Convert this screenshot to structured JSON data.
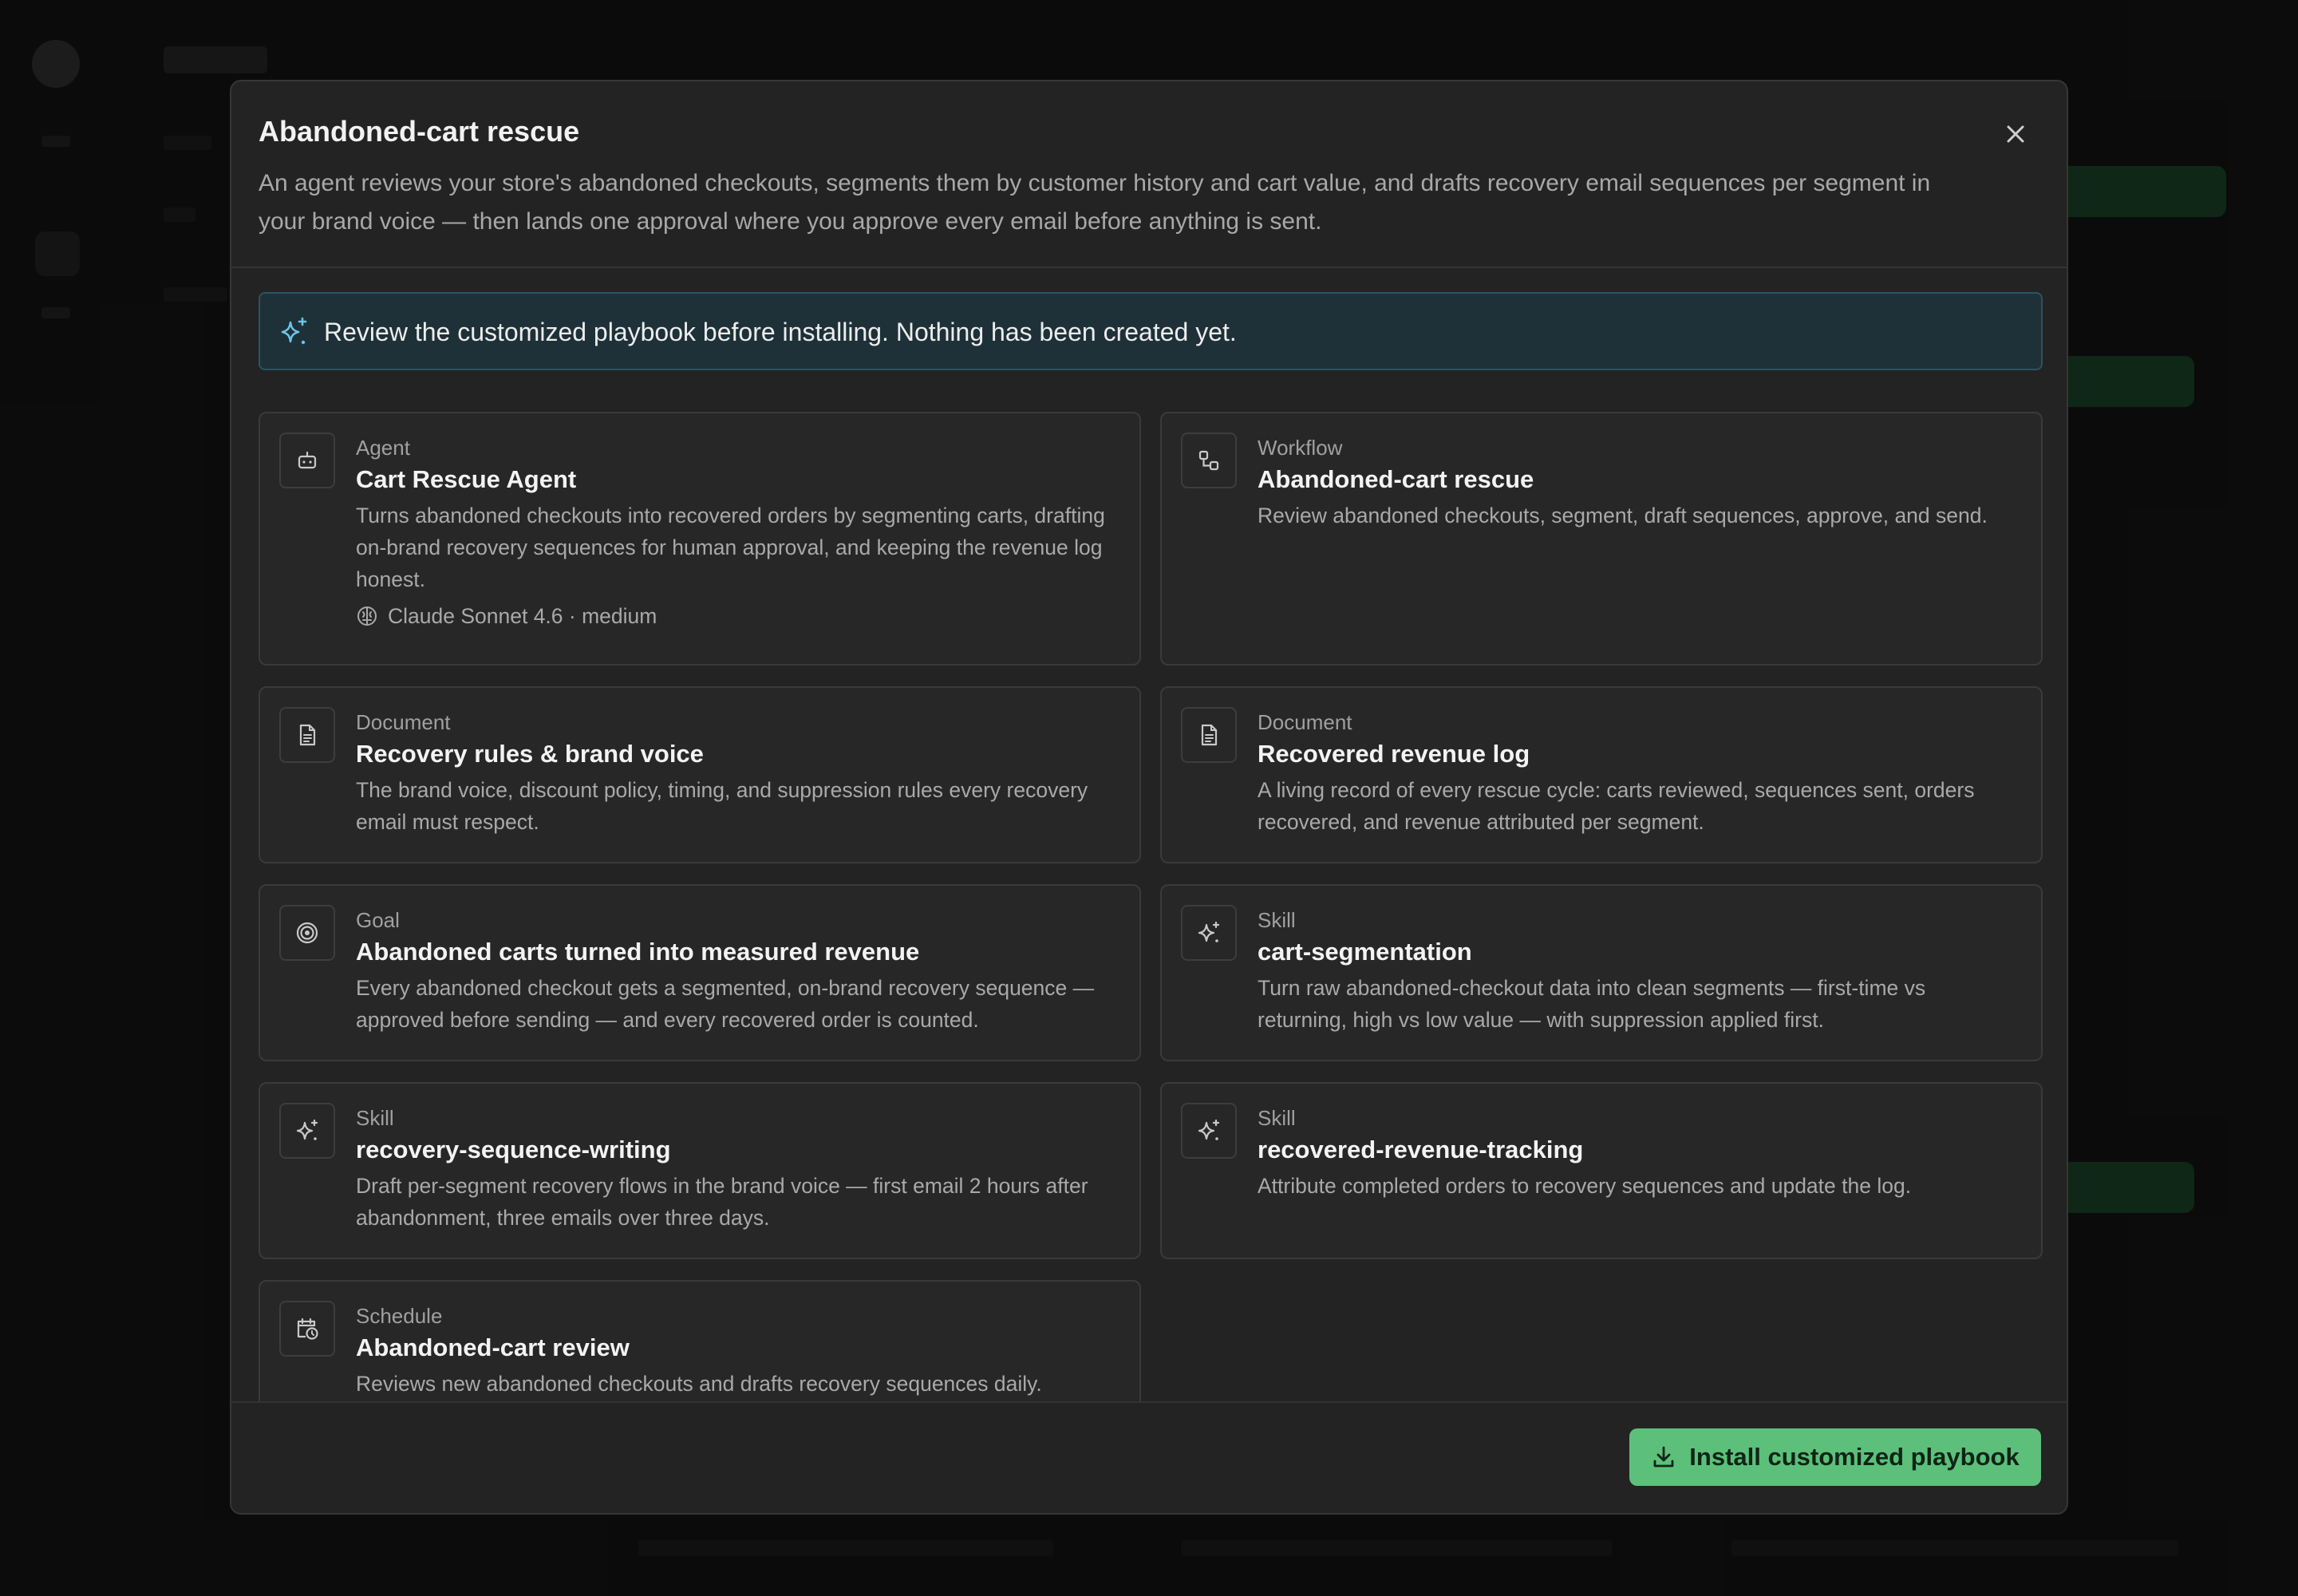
{
  "modal": {
    "title": "Abandoned-cart rescue",
    "description": "An agent reviews your store's abandoned checkouts, segments them by customer history and cart value, and drafts recovery email sequences per segment in your brand voice — then lands one approval where you approve every email before anything is sent."
  },
  "banner": {
    "text": "Review the customized playbook before installing. Nothing has been created yet."
  },
  "cards": [
    {
      "type": "Agent",
      "name": "Cart Rescue Agent",
      "description": "Turns abandoned checkouts into recovered orders by segmenting carts, drafting on-brand recovery sequences for human approval, and keeping the revenue log honest.",
      "model": "Claude Sonnet 4.6 · medium",
      "icon": "robot-icon"
    },
    {
      "type": "Workflow",
      "name": "Abandoned-cart rescue",
      "description": "Review abandoned checkouts, segment, draft sequences, approve, and send.",
      "icon": "workflow-icon"
    },
    {
      "type": "Document",
      "name": "Recovery rules & brand voice",
      "description": "The brand voice, discount policy, timing, and suppression rules every recovery email must respect.",
      "icon": "document-icon"
    },
    {
      "type": "Document",
      "name": "Recovered revenue log",
      "description": "A living record of every rescue cycle: carts reviewed, sequences sent, orders recovered, and revenue attributed per segment.",
      "icon": "document-icon"
    },
    {
      "type": "Goal",
      "name": "Abandoned carts turned into measured revenue",
      "description": "Every abandoned checkout gets a segmented, on-brand recovery sequence — approved before sending — and every recovered order is counted.",
      "icon": "target-icon"
    },
    {
      "type": "Skill",
      "name": "cart-segmentation",
      "description": "Turn raw abandoned-checkout data into clean segments — first-time vs returning, high vs low value — with suppression applied first.",
      "icon": "sparkle-icon"
    },
    {
      "type": "Skill",
      "name": "recovery-sequence-writing",
      "description": "Draft per-segment recovery flows in the brand voice — first email 2 hours after abandonment, three emails over three days.",
      "icon": "sparkle-icon"
    },
    {
      "type": "Skill",
      "name": "recovered-revenue-tracking",
      "description": "Attribute completed orders to recovery sequences and update the log.",
      "icon": "sparkle-icon"
    },
    {
      "type": "Schedule",
      "name": "Abandoned-cart review",
      "description": "Reviews new abandoned checkouts and drafts recovery sequences daily.",
      "icon": "calendar-clock-icon"
    }
  ],
  "footer": {
    "install_label": "Install customized playbook"
  },
  "colors": {
    "accent_green": "#5cc07a",
    "banner_bg": "#1e3139",
    "banner_border": "#2c5363",
    "banner_icon": "#6ec3e6",
    "modal_bg": "#232323"
  }
}
